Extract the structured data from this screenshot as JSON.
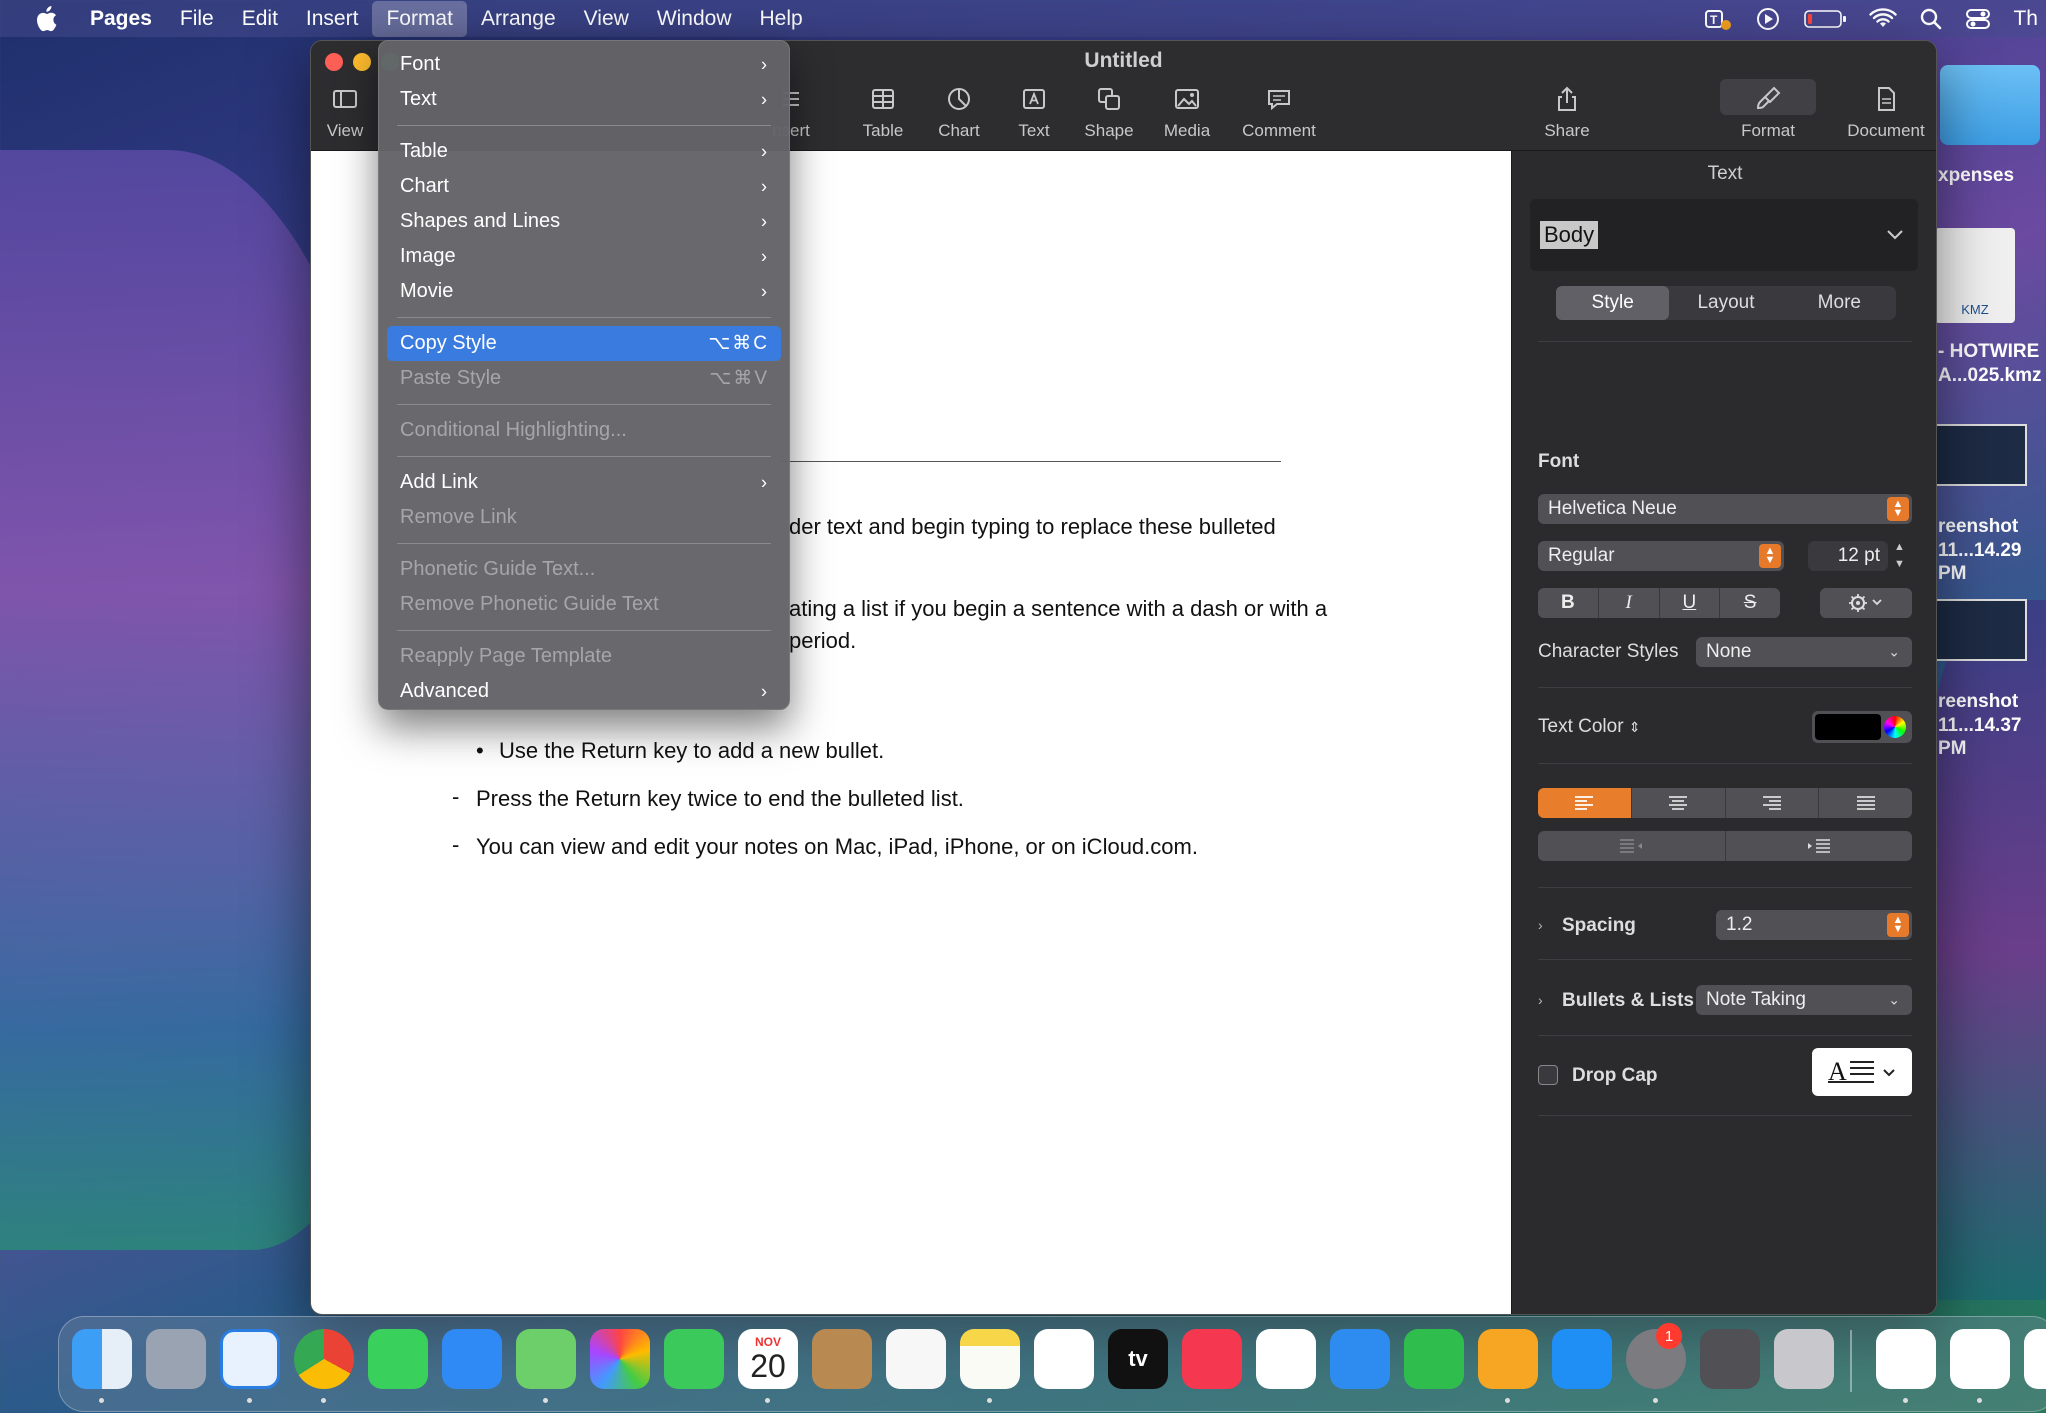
{
  "menubar": {
    "app_name": "Pages",
    "items": [
      "File",
      "Edit",
      "Insert",
      "Format",
      "Arrange",
      "View",
      "Window",
      "Help"
    ],
    "active_menu": "Format",
    "clock_fragment": "Th"
  },
  "window": {
    "title": "Untitled",
    "toolbar": {
      "view": "View",
      "insert": "Insert",
      "insert_visible": "nsert",
      "table": "Table",
      "chart": "Chart",
      "text": "Text",
      "shape": "Shape",
      "media": "Media",
      "comment": "Comment",
      "share": "Share",
      "format": "Format",
      "document": "Document"
    }
  },
  "format_menu": {
    "font": "Font",
    "text": "Text",
    "table": "Table",
    "chart": "Chart",
    "shapes_and_lines": "Shapes and Lines",
    "image": "Image",
    "movie": "Movie",
    "copy_style": "Copy Style",
    "copy_style_shortcut": "⌥⌘C",
    "paste_style": "Paste Style",
    "paste_style_shortcut": "⌥⌘V",
    "conditional_highlighting": "Conditional Highlighting...",
    "add_link": "Add Link",
    "remove_link": "Remove Link",
    "phonetic_guide_text": "Phonetic Guide Text...",
    "remove_phonetic_guide_text": "Remove Phonetic Guide Text",
    "reapply_page_template": "Reapply Page Template",
    "advanced": "Advanced"
  },
  "document": {
    "line1": "der text and begin typing to replace these bulleted",
    "line2": "ating a list if you begin a sentence with a dash or with a",
    "line3": "period.",
    "bullet1": "Use the Return key to add a new bullet.",
    "dash1": "Press the Return key twice to end the bulleted list.",
    "dash2": "You can view and edit your notes on Mac, iPad, iPhone, or on iCloud.com.",
    "bullet_glyph": "•",
    "dash_glyph": "-"
  },
  "inspector": {
    "header": "Text",
    "paragraph_style": "Body",
    "tabs": [
      "Style",
      "Layout",
      "More"
    ],
    "active_tab": "Style",
    "font_label": "Font",
    "font_family": "Helvetica Neue",
    "font_weight": "Regular",
    "font_size": "12 pt",
    "bold": "B",
    "italic": "I",
    "underline": "U",
    "strike": "S",
    "character_styles_label": "Character Styles",
    "character_styles_value": "None",
    "text_color_label": "Text Color",
    "text_color": "#000000",
    "spacing_label": "Spacing",
    "spacing_value": "1.2",
    "bullets_label": "Bullets & Lists",
    "bullets_value": "Note Taking",
    "drop_cap_label": "Drop Cap",
    "accent_color": "#e87d2c"
  },
  "desktop": {
    "folder_label": "xpenses",
    "kmz_label_1": "- HOTWIRE",
    "kmz_label_2": "A...025.kmz",
    "kmz_badge": "KMZ",
    "shot1_label_1": "reenshot",
    "shot1_label_2": "11...14.29 PM",
    "shot2_label_1": "reenshot",
    "shot2_label_2": "11...14.37 PM"
  },
  "dock": {
    "calendar_month": "NOV",
    "calendar_day": "20",
    "settings_badge": "1",
    "tv_label": "tv"
  }
}
